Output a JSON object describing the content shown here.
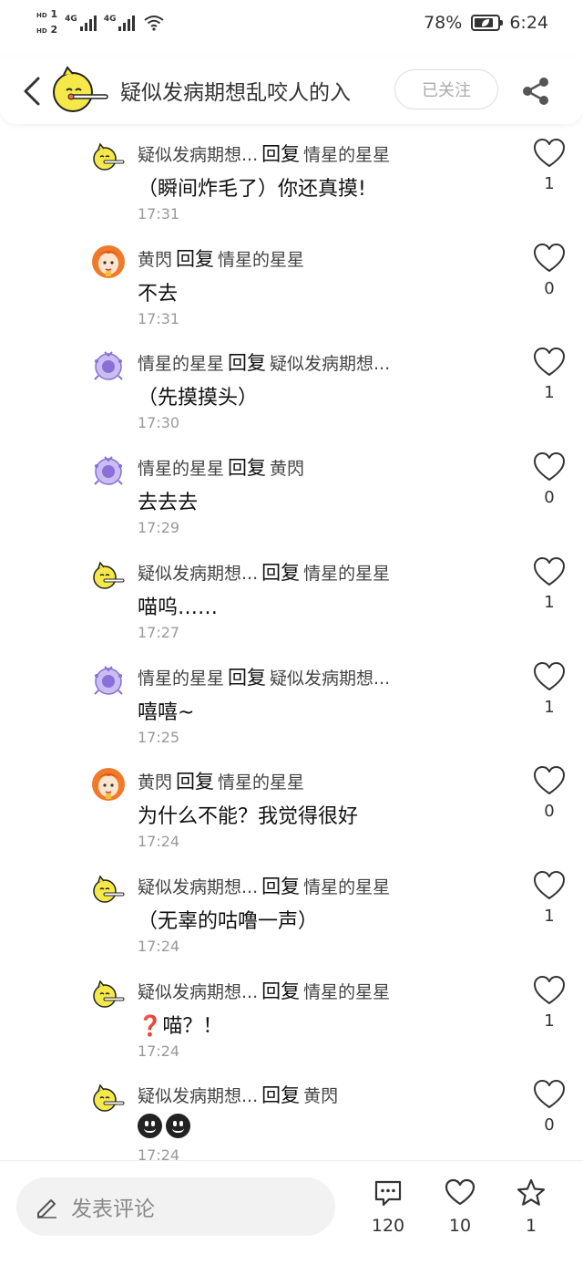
{
  "status_bar": {
    "battery": "78%",
    "time": "6:24",
    "network": "4G",
    "sim1": "HD",
    "sim2": "HD"
  },
  "header": {
    "title": "疑似发病期想乱咬人的入",
    "follow_label": "已关注"
  },
  "comments": [
    {
      "author": "疑似发病期想...",
      "reply_word": "回复",
      "target": "情星的星星",
      "content": "（瞬间炸毛了）你还真摸!",
      "time": "17:31",
      "likes": "1",
      "avatar": "yellow"
    },
    {
      "author": "黄閃",
      "reply_word": "回复",
      "target": "情星的星星",
      "content": "不去",
      "time": "17:31",
      "likes": "0",
      "avatar": "orange"
    },
    {
      "author": "情星的星星",
      "reply_word": "回复",
      "target": "疑似发病期想...",
      "content": "（先摸摸头）",
      "time": "17:30",
      "likes": "1",
      "avatar": "purple"
    },
    {
      "author": "情星的星星",
      "reply_word": "回复",
      "target": "黄閃",
      "content": "去去去",
      "time": "17:29",
      "likes": "0",
      "avatar": "purple"
    },
    {
      "author": "疑似发病期想...",
      "reply_word": "回复",
      "target": "情星的星星",
      "content": "喵呜……",
      "time": "17:27",
      "likes": "1",
      "avatar": "yellow"
    },
    {
      "author": "情星的星星",
      "reply_word": "回复",
      "target": "疑似发病期想...",
      "content": "嘻嘻~",
      "time": "17:25",
      "likes": "1",
      "avatar": "purple"
    },
    {
      "author": "黄閃",
      "reply_word": "回复",
      "target": "情星的星星",
      "content": "为什么不能？我觉得很好",
      "time": "17:24",
      "likes": "0",
      "avatar": "orange"
    },
    {
      "author": "疑似发病期想...",
      "reply_word": "回复",
      "target": "情星的星星",
      "content": "（无辜的咕噜一声）",
      "time": "17:24",
      "likes": "1",
      "avatar": "yellow"
    },
    {
      "author": "疑似发病期想...",
      "reply_word": "回复",
      "target": "情星的星星",
      "content": "喵？！",
      "content_prefix": "❓",
      "time": "17:24",
      "likes": "1",
      "avatar": "yellow"
    },
    {
      "author": "疑似发病期想...",
      "reply_word": "回复",
      "target": "黄閃",
      "content": "",
      "content_emojis": [
        "black-smiley-icon",
        "black-smiley-icon"
      ],
      "time": "17:24",
      "likes": "0",
      "avatar": "yellow"
    }
  ],
  "bottom_bar": {
    "input_placeholder": "发表评论",
    "comment_count": "120",
    "like_count": "10",
    "favorite_count": "1"
  },
  "colors": {
    "yellow_avatar": "#f5e94a",
    "orange_avatar": "#f07a2a",
    "purple_avatar": "#8a6fd6",
    "question_mark": "#e0242a"
  }
}
